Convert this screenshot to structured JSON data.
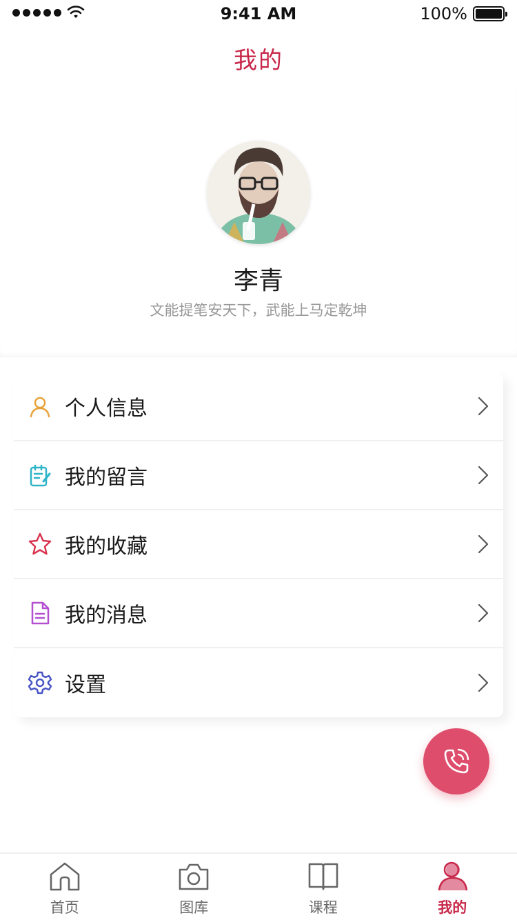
{
  "status_bar": {
    "time": "9:41 AM",
    "battery": "100%",
    "icons": [
      "signal-icon",
      "wifi-icon",
      "battery-icon"
    ]
  },
  "nav": {
    "title": "我的"
  },
  "profile": {
    "name": "李青",
    "motto": "文能提笔安天下，武能上马定乾坤"
  },
  "menu": {
    "items": [
      {
        "label": "个人信息",
        "icon": "user-icon",
        "color": "#E8A23A"
      },
      {
        "label": "我的留言",
        "icon": "note-icon",
        "color": "#2DB4C8"
      },
      {
        "label": "我的收藏",
        "icon": "star-icon",
        "color": "#D9344F"
      },
      {
        "label": "我的消息",
        "icon": "document-icon",
        "color": "#B34FD0"
      },
      {
        "label": "设置",
        "icon": "gear-icon",
        "color": "#51644F"
      }
    ]
  },
  "tabbar": {
    "tabs": [
      {
        "label": "首页",
        "icon": "home-icon"
      },
      {
        "label": "图库",
        "icon": "camera-icon"
      },
      {
        "label": "课程",
        "icon": "book-icon"
      },
      {
        "label": "我的",
        "icon": "profile-icon",
        "active": true
      }
    ]
  },
  "colors": {
    "accent": "#C8284A",
    "fab": "#DE4D6B",
    "text_primary": "#1A1A1A",
    "text_secondary": "#999999",
    "divider": "#F0F0F0",
    "card_bg": "#FFFFFF"
  }
}
